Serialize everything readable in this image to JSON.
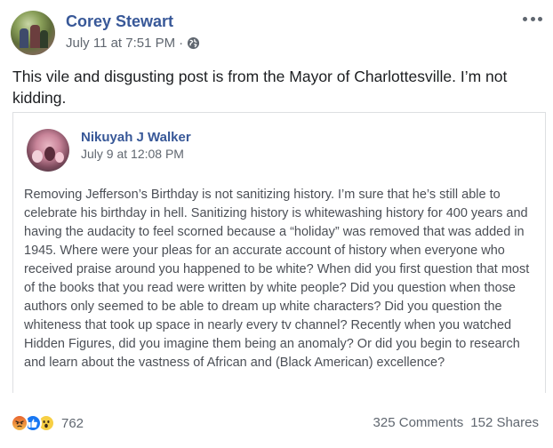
{
  "author": {
    "name": "Corey Stewart",
    "timestamp": "July 11 at 7:51 PM",
    "separator": "·",
    "privacy_icon": "globe-icon"
  },
  "post_text": "This vile and disgusting post is from the Mayor of Charlottesville. I’m not kidding.",
  "shared_post": {
    "author_name": "Nikuyah J Walker",
    "timestamp": "July 9 at 12:08 PM",
    "text": "Removing Jefferson’s Birthday is not sanitizing history. I’m sure that he’s still able to celebrate his birthday in hell. Sanitizing history is whitewashing history for 400 years and having the audacity to feel scorned because a “holiday” was removed that was added in 1945. Where were your pleas for an accurate account of history when everyone who received praise around you happened to be white? When did you first question that most of the books that you read were written by white people? Did you question when those authors only seemed to be able to dream up white characters? Did you question the whiteness that took up space in nearly every tv channel? Recently when you watched Hidden Figures, did you imagine them being an anomaly? Or did you begin to research and learn about the vastness of African and (Black American) excellence?"
  },
  "footer": {
    "reactions": [
      "angry-icon",
      "like-icon",
      "wow-icon"
    ],
    "reaction_count": "762",
    "comments": "325 Comments",
    "shares": "152 Shares"
  },
  "colors": {
    "link_blue": "#385898",
    "meta_gray": "#606770",
    "text": "#1c1e21",
    "like_blue": "#1877f2"
  }
}
